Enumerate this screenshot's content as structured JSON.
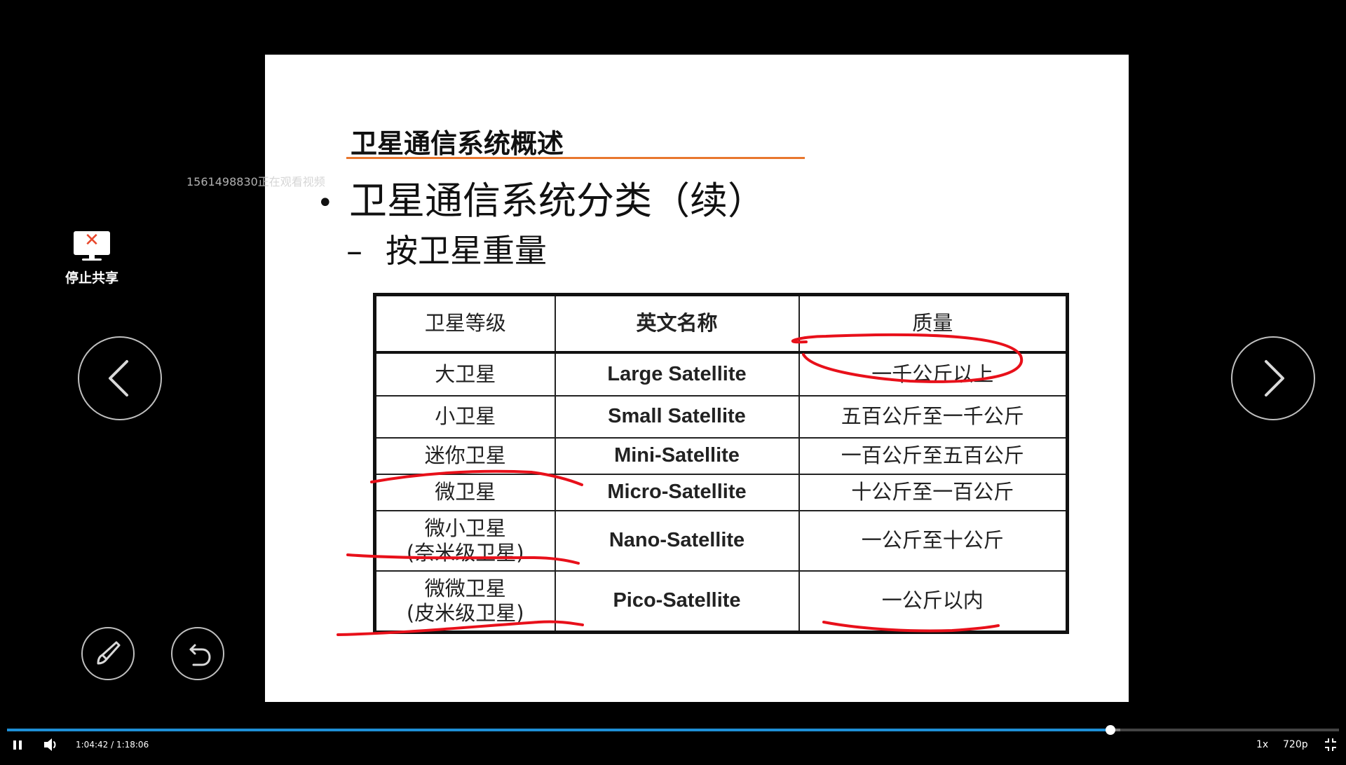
{
  "slide": {
    "heading": "卫星通信系统概述",
    "bullet": "卫星通信系统分类（续）",
    "bullet_marker": "•",
    "sub_marker": "–",
    "sub": "按卫星重量",
    "table": {
      "headers": [
        "卫星等级",
        "英文名称",
        "质量"
      ],
      "rows": [
        {
          "level": "大卫星",
          "level2": "",
          "en": "Large Satellite",
          "mass": "一千公斤以上"
        },
        {
          "level": "小卫星",
          "level2": "",
          "en": "Small Satellite",
          "mass": "五百公斤至一千公斤"
        },
        {
          "level": "迷你卫星",
          "level2": "",
          "en": "Mini-Satellite",
          "mass": "一百公斤至五百公斤"
        },
        {
          "level": "微卫星",
          "level2": "",
          "en": "Micro-Satellite",
          "mass": "十公斤至一百公斤"
        },
        {
          "level": "微小卫星",
          "level2": "(奈米级卫星)",
          "en": "Nano-Satellite",
          "mass": "一公斤至十公斤"
        },
        {
          "level": "微微卫星",
          "level2": "(皮米级卫星)",
          "en": "Pico-Satellite",
          "mass": "一公斤以内"
        }
      ]
    }
  },
  "watermark": "1561498830正在观看视频",
  "stop_share": {
    "label": "停止共享",
    "icon": "monitor-x-icon"
  },
  "player": {
    "current_time": "1:04:42",
    "total_time": "1:18:06",
    "time_separator": " / ",
    "progress": 0.8284,
    "buffered": 0.836,
    "rate": "1x",
    "quality": "720p"
  },
  "colors": {
    "accent": "#1e8fd6",
    "ink": "#e8101a",
    "heading_rule": "#e8772e"
  }
}
